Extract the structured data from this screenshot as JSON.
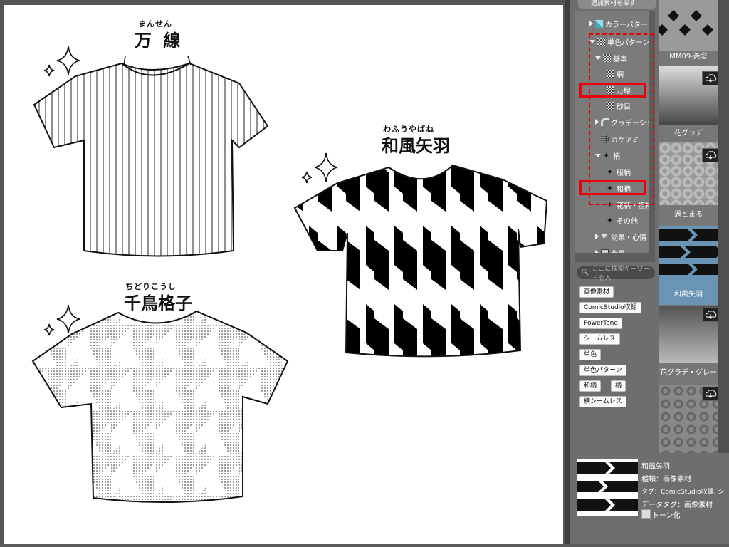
{
  "illustration": {
    "shirt1": {
      "title": "万 線",
      "ruby": "まんせん"
    },
    "shirt2": {
      "title": "和風矢羽",
      "ruby": "わふうやばね"
    },
    "shirt3": {
      "title": "千鳥格子",
      "ruby": "ちどりこうし"
    }
  },
  "panel": {
    "header_label": "追加素材を探す",
    "tree": [
      {
        "label": "カラーパターン"
      },
      {
        "label": "単色パターン"
      },
      {
        "label": "基本"
      },
      {
        "label": "網"
      },
      {
        "label": "万線"
      },
      {
        "label": "砂目"
      },
      {
        "label": "グラデーション"
      },
      {
        "label": "カケアミ"
      },
      {
        "label": "柄"
      },
      {
        "label": "服柄"
      },
      {
        "label": "和柄"
      },
      {
        "label": "花柄・植物"
      },
      {
        "label": "その他"
      },
      {
        "label": "効果・心情"
      },
      {
        "label": "背景"
      }
    ],
    "search_placeholder": "ここに検索キーワードを入",
    "tags": [
      "画像素材",
      "ComicStudio収録",
      "PowerTone",
      "シームレス",
      "単色",
      "単色パターン",
      "和柄",
      "柄",
      "横シームレス"
    ],
    "thumbnails": [
      {
        "label": "MM09-菱窓"
      },
      {
        "label": "花グラデ"
      },
      {
        "label": "渦とまる"
      },
      {
        "label": "和風矢羽"
      },
      {
        "label": "花グラデ・グレー"
      }
    ],
    "info": {
      "name": "和風矢羽",
      "type": "種類：画像素材",
      "tags": "タグ：ComicStudio収録, シームレス",
      "datatag": "データタグ：画像素材",
      "tone_label": "トーン化"
    },
    "accent_colors": {
      "highlight": "#e8000b",
      "selected": "#6a94b4"
    }
  }
}
